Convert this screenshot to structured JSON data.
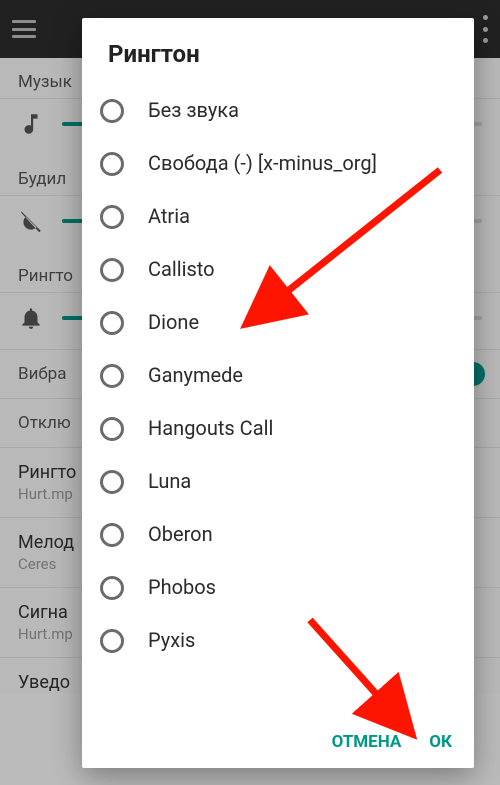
{
  "appbar": {
    "menu_icon": "menu-icon",
    "overflow_icon": "overflow-icon"
  },
  "background": {
    "sections": [
      {
        "label": "Музык"
      },
      {
        "label": "Будил"
      },
      {
        "label": "Рингто"
      },
      {
        "label": "Вибра"
      },
      {
        "label": "Отклю"
      }
    ],
    "item1": {
      "title": "Рингто",
      "sub": "Hurt.mp"
    },
    "item2": {
      "title": "Мелод",
      "sub": "Ceres"
    },
    "item3": {
      "title": "Сигна",
      "sub": "Hurt.mp"
    },
    "item4": {
      "title": "Уведо"
    }
  },
  "dialog": {
    "title": "Рингтон",
    "options": [
      {
        "label": "Без звука"
      },
      {
        "label": "Свобода (-) [x-minus_org]"
      },
      {
        "label": "Atria"
      },
      {
        "label": "Callisto"
      },
      {
        "label": "Dione"
      },
      {
        "label": "Ganymede"
      },
      {
        "label": "Hangouts Call"
      },
      {
        "label": "Luna"
      },
      {
        "label": "Oberon"
      },
      {
        "label": "Phobos"
      },
      {
        "label": "Pyxis"
      }
    ],
    "actions": {
      "cancel": "ОТМЕНА",
      "ok": "ОК"
    }
  },
  "annotations": {
    "arrow_to_option": "Dione",
    "arrow_to_button": "ОК"
  }
}
